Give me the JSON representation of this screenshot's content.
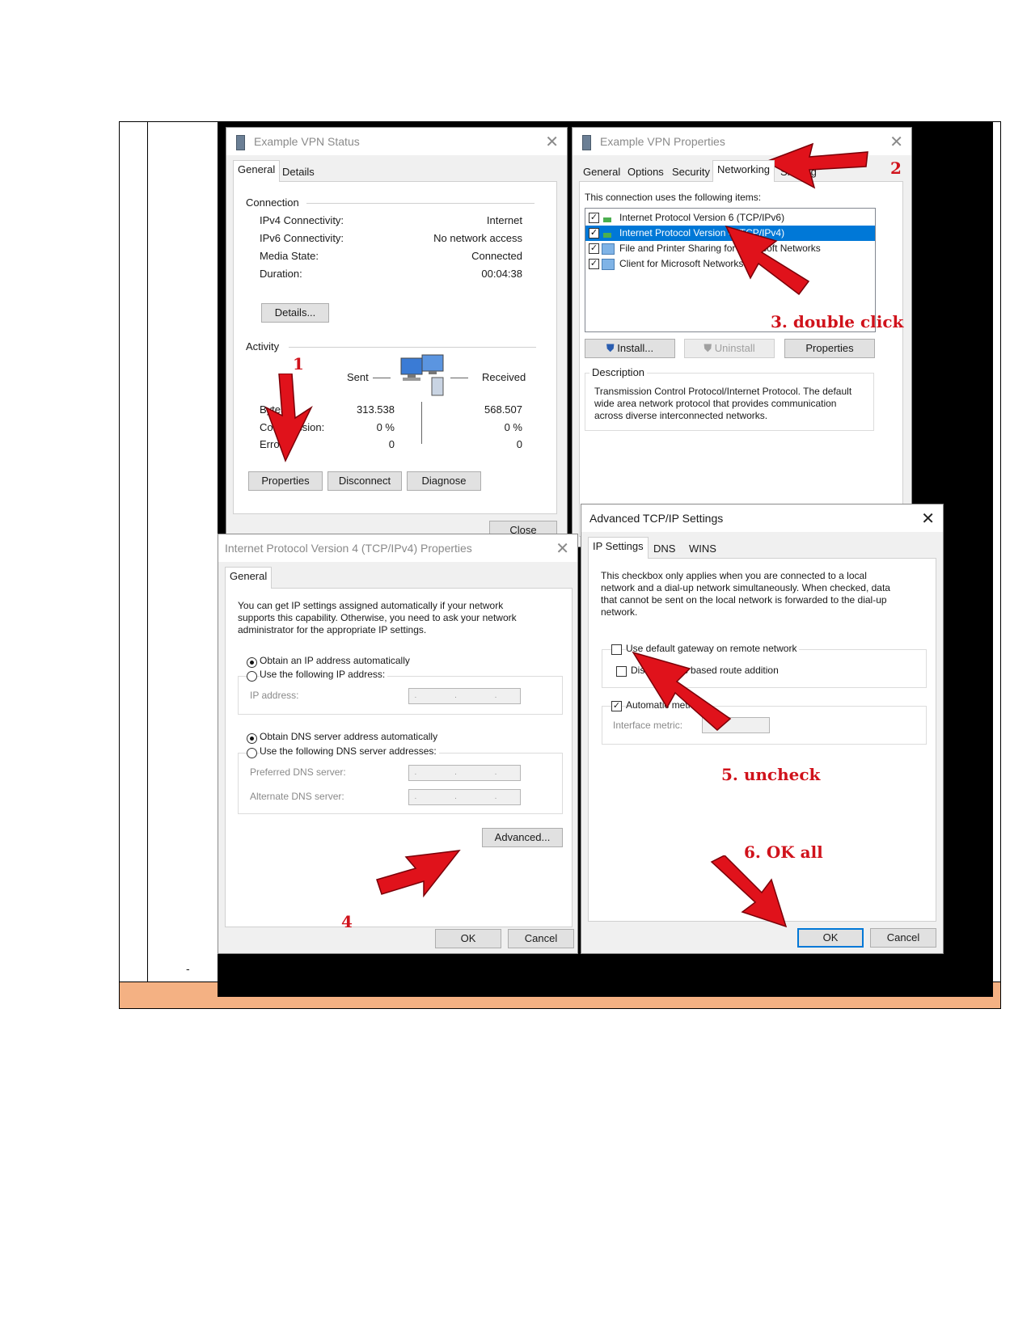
{
  "footnote_mark": "-",
  "colors": {
    "accent": "#0078d7",
    "annotation": "#e0121b",
    "table_band": "#f4b183"
  },
  "vpn_status": {
    "title": "Example VPN Status",
    "tabs": [
      "General",
      "Details"
    ],
    "connection_label": "Connection",
    "rows": [
      {
        "label": "IPv4 Connectivity:",
        "value": "Internet"
      },
      {
        "label": "IPv6 Connectivity:",
        "value": "No network access"
      },
      {
        "label": "Media State:",
        "value": "Connected"
      },
      {
        "label": "Duration:",
        "value": "00:04:38"
      }
    ],
    "details_button": "Details...",
    "activity_label": "Activity",
    "sent_label": "Sent",
    "received_label": "Received",
    "stats": [
      {
        "label": "Bytes:",
        "sent": "313.538",
        "received": "568.507"
      },
      {
        "label": "Compression:",
        "sent": "0 %",
        "received": "0 %"
      },
      {
        "label": "Errors:",
        "sent": "0",
        "received": "0"
      }
    ],
    "buttons": [
      "Properties",
      "Disconnect",
      "Diagnose"
    ],
    "close_button": "Close"
  },
  "vpn_properties": {
    "title": "Example VPN Properties",
    "tabs": [
      "General",
      "Options",
      "Security",
      "Networking",
      "Sharing"
    ],
    "items_label": "This connection uses the following items:",
    "items": [
      {
        "label": "Internet Protocol Version 6 (TCP/IPv6)",
        "checked": true,
        "selected": false
      },
      {
        "label": "Internet Protocol Version 4 (TCP/IPv4)",
        "checked": true,
        "selected": true
      },
      {
        "label": "File and Printer Sharing for Microsoft Networks",
        "checked": true,
        "selected": false
      },
      {
        "label": "Client for Microsoft Networks",
        "checked": true,
        "selected": false
      }
    ],
    "install_button": "Install...",
    "uninstall_button": "Uninstall",
    "properties_button": "Properties",
    "description_label": "Description",
    "description_text": "Transmission Control Protocol/Internet Protocol. The default wide area network protocol that provides communication across diverse interconnected networks."
  },
  "ipv4_properties": {
    "title": "Internet Protocol Version 4 (TCP/IPv4) Properties",
    "tab": "General",
    "intro": "You can get IP settings assigned automatically if your network supports this capability. Otherwise, you need to ask your network administrator for the appropriate IP settings.",
    "obtain_ip": "Obtain an IP address automatically",
    "use_ip": "Use the following IP address:",
    "ip_address_label": "IP address:",
    "obtain_dns": "Obtain DNS server address automatically",
    "use_dns": "Use the following DNS server addresses:",
    "preferred_dns_label": "Preferred DNS server:",
    "alternate_dns_label": "Alternate DNS server:",
    "ip_placeholder": ". . .",
    "advanced_button": "Advanced...",
    "ok_button": "OK",
    "cancel_button": "Cancel"
  },
  "advanced_tcpip": {
    "title": "Advanced TCP/IP Settings",
    "tabs": [
      "IP Settings",
      "DNS",
      "WINS"
    ],
    "info": "This checkbox only applies when you are connected to a local network and a dial-up network simultaneously.  When checked, data that cannot be sent on the local network is forwarded to the dial-up network.",
    "use_default_gateway": "Use default gateway on remote network",
    "disable_class_route": "Disable class based route addition",
    "automatic_metric": "Automatic metric",
    "interface_metric_label": "Interface metric:",
    "ok_button": "OK",
    "cancel_button": "Cancel"
  },
  "annotations": {
    "step1": "1",
    "step2": "2",
    "step3": "3. double click",
    "step4": "4",
    "step5": "5. uncheck",
    "step6": "6. OK all"
  }
}
